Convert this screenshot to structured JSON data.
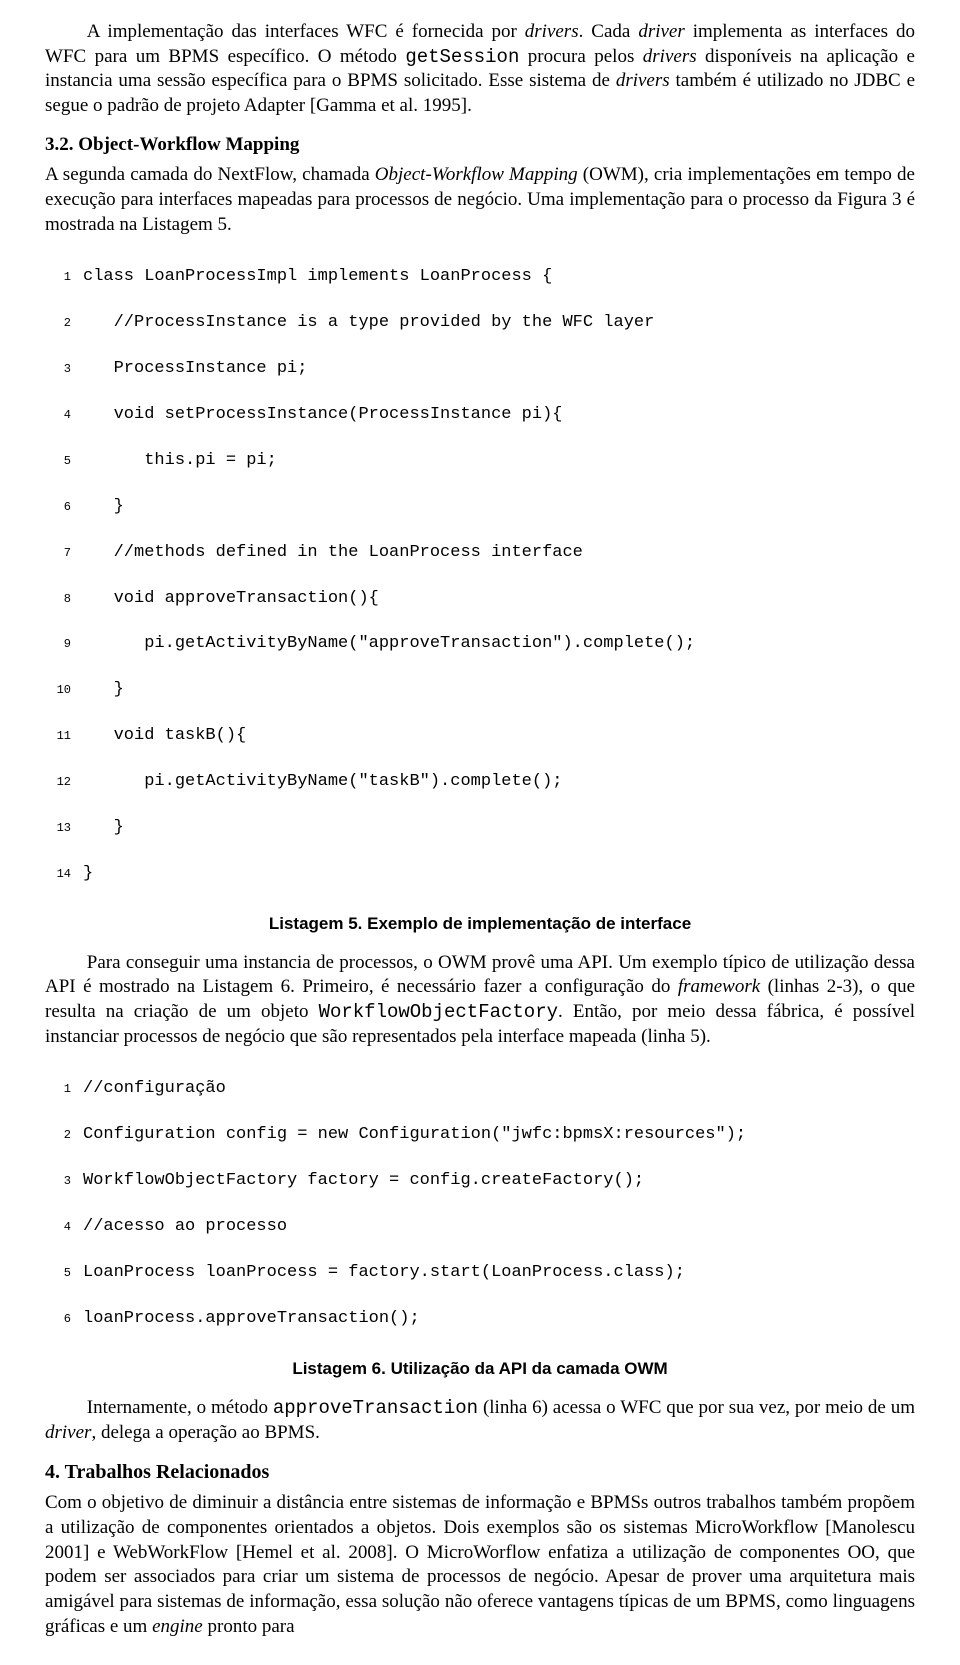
{
  "para1_a": "A implementação das interfaces WFC é fornecida por ",
  "para1_b": "drivers",
  "para1_c": ". Cada ",
  "para1_d": "driver",
  "para1_e": " implementa as interfaces do WFC para um BPMS específico. O método ",
  "para1_f": "getSession",
  "para1_g": " procura pelos ",
  "para1_h": "drivers",
  "para1_i": " disponíveis na aplicação e instancia uma sessão específica para o BPMS solicitado. Esse sistema de ",
  "para1_j": "drivers",
  "para1_k": " também é utilizado no JDBC e segue o padrão de projeto Adapter [Gamma et al. 1995].",
  "sec32": "3.2. Object-Workflow Mapping",
  "para2_a": "A segunda camada do NextFlow, chamada ",
  "para2_b": "Object-Workflow Mapping",
  "para2_c": " (OWM), cria implementações em tempo de execução para interfaces mapeadas para processos de negócio. Uma implementação para o processo da Figura 3 é mostrada na Listagem 5.",
  "l5": {
    "1": "class LoanProcessImpl implements LoanProcess {",
    "2": "   //ProcessInstance is a type provided by the WFC layer",
    "3": "   ProcessInstance pi;",
    "4": "   void setProcessInstance(ProcessInstance pi){",
    "5": "      this.pi = pi;",
    "6": "   }",
    "7": "   //methods defined in the LoanProcess interface",
    "8": "   void approveTransaction(){",
    "9": "      pi.getActivityByName(\"approveTransaction\").complete();",
    "10": "   }",
    "11": "   void taskB(){",
    "12": "      pi.getActivityByName(\"taskB\").complete();",
    "13": "   }",
    "14": "}"
  },
  "caption5": "Listagem 5. Exemplo de implementação de interface",
  "para3_a": "Para conseguir uma instancia de processos, o OWM provê uma API. Um exemplo típico de utilização dessa API é mostrado na Listagem 6. Primeiro, é necessário fazer a configuração do ",
  "para3_b": "framework",
  "para3_c": " (linhas 2-3), o que resulta na criação de um objeto ",
  "para3_d": "WorkflowObjectFactory",
  "para3_e": ". Então, por meio dessa fábrica, é possível instanciar processos de negócio que são representados pela interface mapeada (linha 5).",
  "l6": {
    "1": "//configuração",
    "2": "Configuration config = new Configuration(\"jwfc:bpmsX:resources\");",
    "3": "WorkflowObjectFactory factory = config.createFactory();",
    "4": "//acesso ao processo",
    "5": "LoanProcess loanProcess = factory.start(LoanProcess.class);",
    "6": "loanProcess.approveTransaction();"
  },
  "caption6": "Listagem 6. Utilização da API da camada OWM",
  "para4_a": "Internamente, o método ",
  "para4_b": "approveTransaction",
  "para4_c": " (linha 6) acessa o WFC que por sua vez, por meio de um ",
  "para4_d": "driver",
  "para4_e": ", delega a operação ao BPMS.",
  "sec4": "4. Trabalhos Relacionados",
  "para5": "Com o objetivo de diminuir a distância entre sistemas de informação e BPMSs outros trabalhos também propõem a utilização de componentes orientados a objetos. Dois exemplos são os sistemas MicroWorkflow [Manolescu 2001] e WebWorkFlow [Hemel et al. 2008]. O MicroWorflow enfatiza a utilização de componentes OO, que podem ser associados para criar um sistema de processos de negócio. Apesar de prover uma arquitetura mais amigável para sistemas de informação, essa solução não oferece vantagens típicas de um BPMS, como linguagens gráficas e um ",
  "para5_b": "engine",
  "para5_c": " pronto para"
}
